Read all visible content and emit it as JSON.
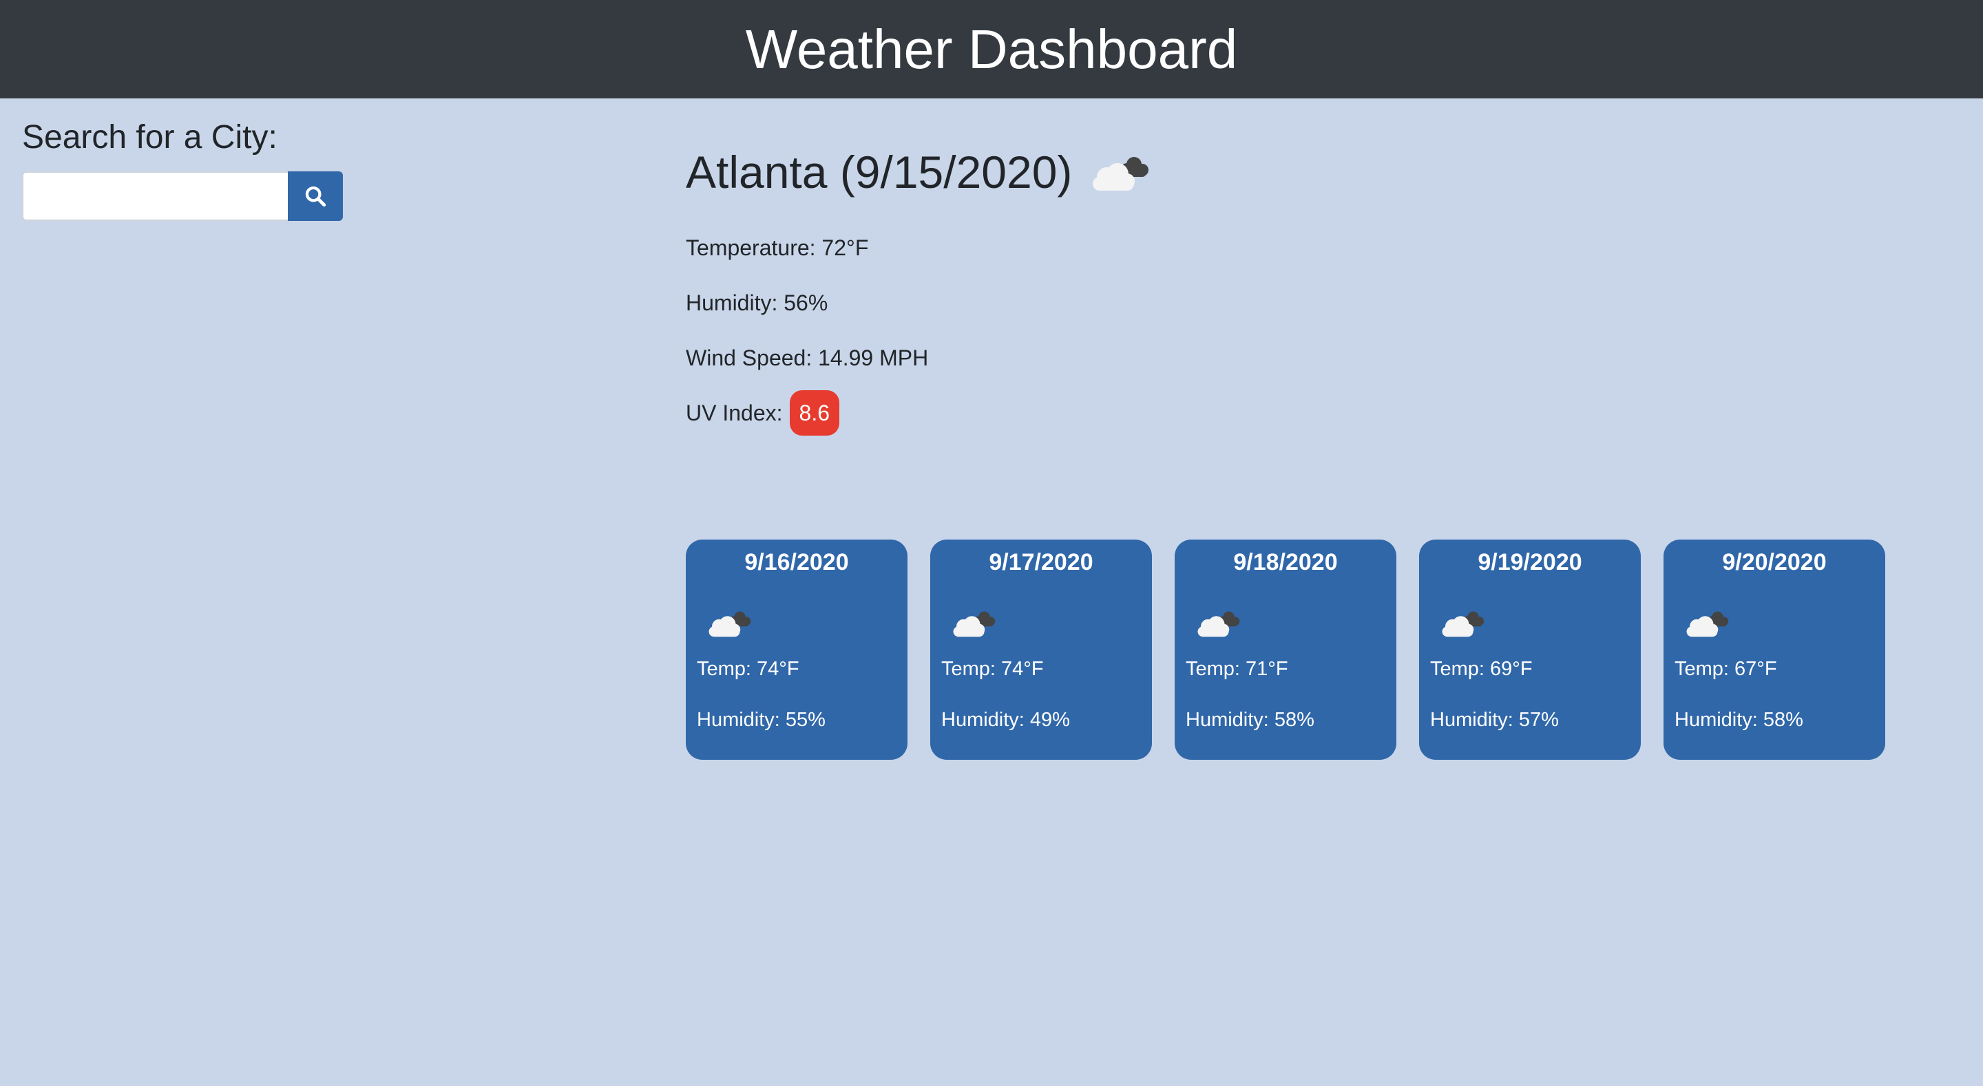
{
  "header": {
    "title": "Weather Dashboard"
  },
  "search": {
    "label": "Search for a City:",
    "value": "",
    "placeholder": "",
    "button_icon": "search-icon"
  },
  "current": {
    "title": "Atlanta (9/15/2020)",
    "icon": "cloud-icon",
    "temperature": "Temperature: 72°F",
    "humidity": "Humidity: 56%",
    "wind": "Wind Speed: 14.99 MPH",
    "uv_label": "UV Index:",
    "uv_value": "8.6",
    "uv_color": "#e63b2e"
  },
  "forecast": [
    {
      "date": "9/16/2020",
      "icon": "cloud-icon",
      "temp": "Temp: 74°F",
      "humidity": "Humidity: 55%"
    },
    {
      "date": "9/17/2020",
      "icon": "cloud-icon",
      "temp": "Temp: 74°F",
      "humidity": "Humidity: 49%"
    },
    {
      "date": "9/18/2020",
      "icon": "cloud-icon",
      "temp": "Temp: 71°F",
      "humidity": "Humidity: 58%"
    },
    {
      "date": "9/19/2020",
      "icon": "cloud-icon",
      "temp": "Temp: 69°F",
      "humidity": "Humidity: 57%"
    },
    {
      "date": "9/20/2020",
      "icon": "cloud-icon",
      "temp": "Temp: 67°F",
      "humidity": "Humidity: 58%"
    }
  ],
  "colors": {
    "header_bg": "#343a40",
    "page_bg": "#c9d6e9",
    "accent": "#3067a9"
  }
}
